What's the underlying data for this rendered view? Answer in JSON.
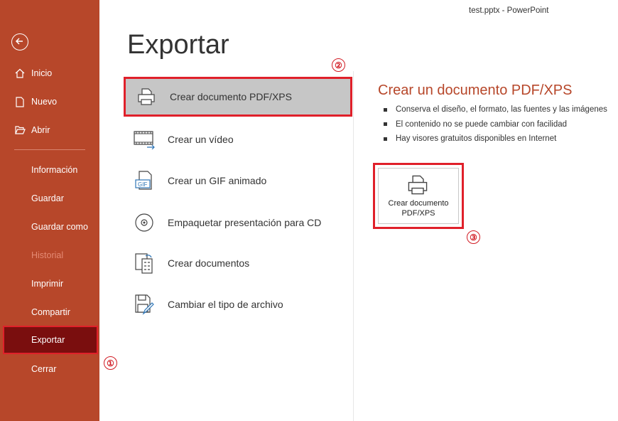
{
  "window": {
    "title": "test.pptx  -  PowerPoint"
  },
  "sidebar": {
    "items": [
      {
        "label": "Inicio"
      },
      {
        "label": "Nuevo"
      },
      {
        "label": "Abrir"
      },
      {
        "label": "Información"
      },
      {
        "label": "Guardar"
      },
      {
        "label": "Guardar como"
      },
      {
        "label": "Historial"
      },
      {
        "label": "Imprimir"
      },
      {
        "label": "Compartir"
      },
      {
        "label": "Exportar"
      },
      {
        "label": "Cerrar"
      }
    ]
  },
  "main": {
    "title": "Exportar",
    "options": [
      {
        "label": "Crear documento PDF/XPS"
      },
      {
        "label": "Crear un vídeo"
      },
      {
        "label": "Crear un GIF animado"
      },
      {
        "label": "Empaquetar presentación para CD"
      },
      {
        "label": "Crear documentos"
      },
      {
        "label": "Cambiar el tipo de archivo"
      }
    ]
  },
  "details": {
    "title": "Crear un documento PDF/XPS",
    "bullets": [
      "Conserva el diseño, el formato, las fuentes y las imágenes",
      "El contenido no se puede cambiar con facilidad",
      "Hay visores gratuitos disponibles en Internet"
    ],
    "button_label": "Crear documento PDF/XPS"
  },
  "annotations": {
    "step1": "①",
    "step2": "②",
    "step3": "③"
  },
  "colors": {
    "sidebar": "#b7472a",
    "active": "#7a0e0e",
    "highlight": "#e0202a"
  }
}
